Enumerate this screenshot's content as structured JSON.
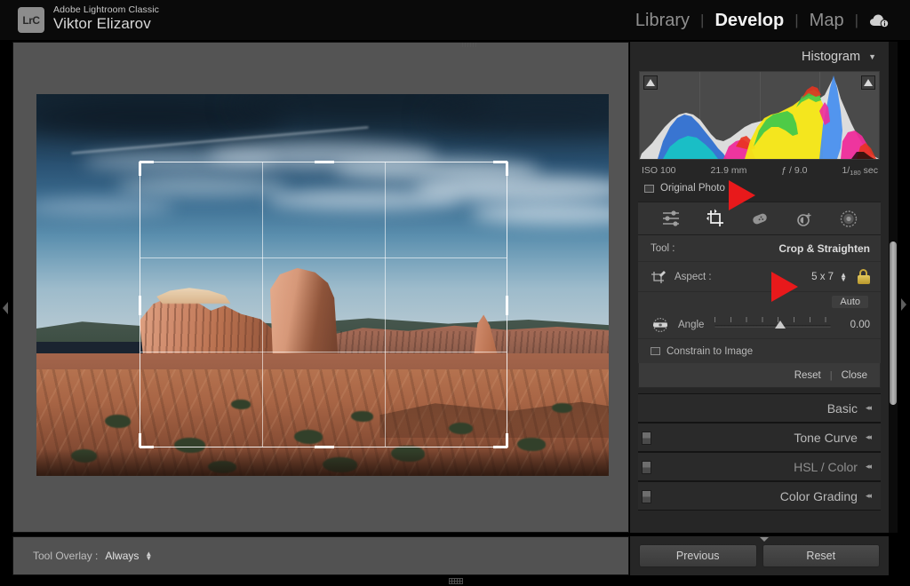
{
  "app": {
    "logo_text": "LrC",
    "product": "Adobe Lightroom Classic",
    "user": "Viktor Elizarov"
  },
  "modules": {
    "items": [
      {
        "label": "Library",
        "active": false
      },
      {
        "label": "Develop",
        "active": true
      },
      {
        "label": "Map",
        "active": false
      }
    ],
    "separator": "|",
    "cloud_icon": "cloud-status-icon"
  },
  "histogram": {
    "title": "Histogram",
    "caret": "▼",
    "shadow_clip_icon": "shadow-clipping-triangle",
    "highlight_clip_icon": "highlight-clipping-triangle",
    "exif": {
      "iso": "ISO 100",
      "focal_length": "21.9 mm",
      "aperture": "ƒ / 9.0",
      "shutter_numerator": "1",
      "shutter_denominator": "180",
      "shutter_suffix": "sec"
    },
    "original_photo_label": "Original Photo",
    "original_photo_checked": false
  },
  "tool_strip": {
    "icons": [
      {
        "name": "basic-adjustments-icon",
        "active": false
      },
      {
        "name": "crop-straighten-icon",
        "active": true
      },
      {
        "name": "healing-brush-icon",
        "active": false
      },
      {
        "name": "red-eye-correction-icon",
        "active": false
      },
      {
        "name": "masking-icon",
        "active": false
      }
    ]
  },
  "crop_tool": {
    "tool_label": "Tool :",
    "tool_value": "Crop & Straighten",
    "aspect_icon": "crop-frame-icon",
    "aspect_label": "Aspect :",
    "aspect_value": "5 x 7",
    "aspect_locked": true,
    "lock_icon": "lock-closed-icon",
    "auto_label": "Auto",
    "angle_icon": "angle-level-icon",
    "angle_label": "Angle",
    "angle_value": "0.00",
    "constrain_label": "Constrain to Image",
    "constrain_checked": false,
    "reset_label": "Reset",
    "separator": "|",
    "close_label": "Close"
  },
  "panels": [
    {
      "label": "Basic",
      "has_switch": false
    },
    {
      "label": "Tone Curve",
      "has_switch": true
    },
    {
      "label": "HSL / Color",
      "has_switch": true
    },
    {
      "label": "Color Grading",
      "has_switch": true
    }
  ],
  "bottom_buttons": {
    "previous": "Previous",
    "reset": "Reset"
  },
  "toolbar": {
    "tool_overlay_label": "Tool Overlay :",
    "tool_overlay_value": "Always"
  },
  "annotations": {
    "arrow_count": 2,
    "arrow_color": "#e8191b",
    "arrow_1_points_to": "original-photo-row",
    "arrow_2_points_to": "aspect-value"
  },
  "colors": {
    "panel_bg": "#262626",
    "stage_bg": "#545454",
    "topbar_bg": "#0a0a0a",
    "accent_lock": "#c8a83c",
    "text_primary": "#d8d8d8",
    "text_secondary": "#a7a7a7"
  }
}
